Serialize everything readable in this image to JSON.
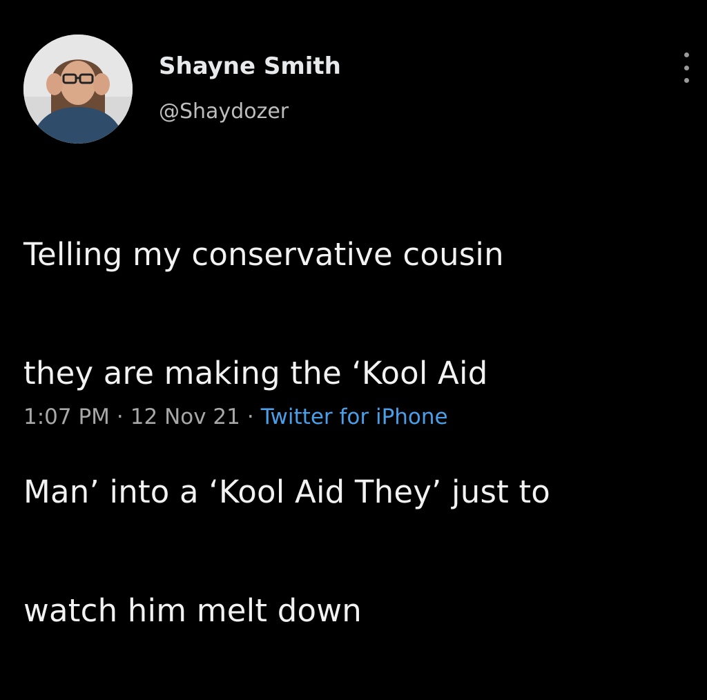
{
  "tweet": {
    "author": {
      "display_name": "Shayne Smith",
      "handle": "@Shaydozer",
      "avatar": "avatar-photo"
    },
    "more_icon": "more-vertical-icon",
    "text_lines": [
      "Telling my conservative cousin",
      "they are making the ‘Kool Aid",
      "Man’ into a ‘Kool Aid They’ just to",
      "watch him melt down"
    ],
    "meta": {
      "time": "1:07 PM",
      "separator": "·",
      "date": "12 Nov 21",
      "source": "Twitter for iPhone"
    },
    "colors": {
      "background": "#000000",
      "text": "#e7e9ea",
      "secondary": "#a8a8a8",
      "link": "#4a9fe8"
    }
  }
}
